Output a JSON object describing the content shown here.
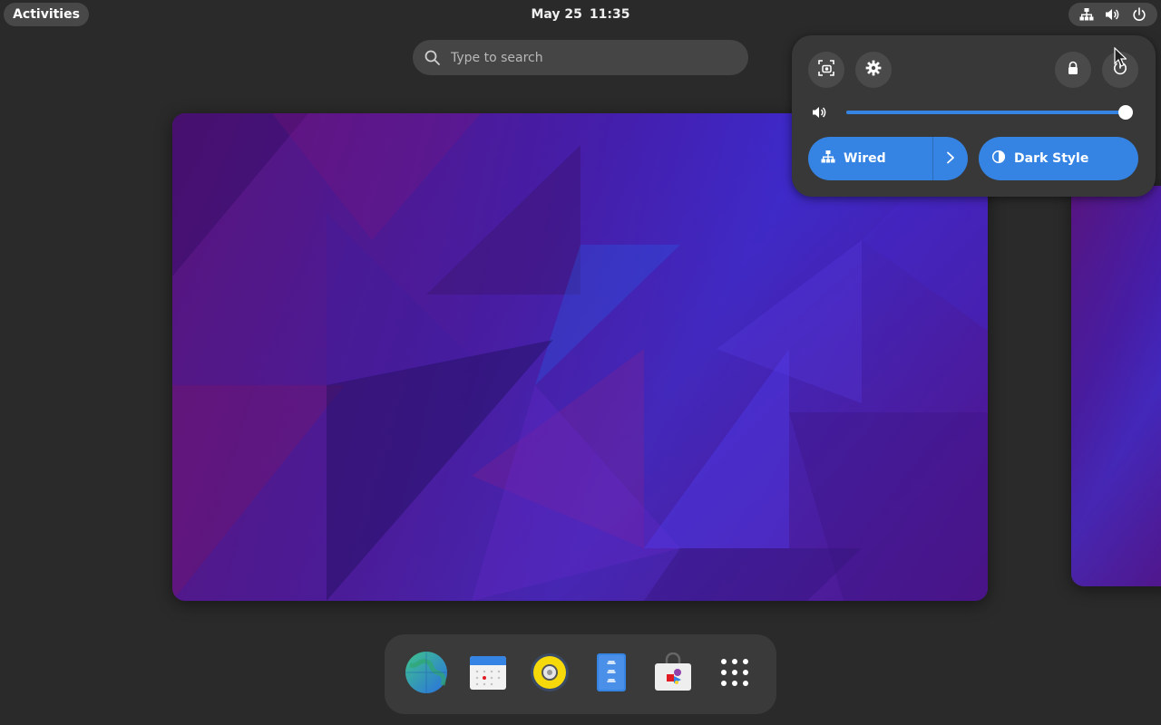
{
  "topbar": {
    "activities_label": "Activities",
    "date": "May 25",
    "time": "11:35",
    "indicators": [
      "network-wired-icon",
      "volume-icon",
      "power-icon"
    ]
  },
  "search": {
    "placeholder": "Type to search"
  },
  "quick_settings": {
    "buttons": [
      "screenshot-icon",
      "settings-gear-icon",
      "lock-icon",
      "power-off-icon"
    ],
    "volume": {
      "level_percent": 100
    },
    "toggles": [
      {
        "label": "Wired",
        "icon": "network-wired-icon",
        "active": true,
        "has_arrow": true
      },
      {
        "label": "Dark Style",
        "icon": "dark-style-icon",
        "active": true,
        "has_arrow": false
      }
    ]
  },
  "dock": {
    "apps": [
      {
        "name": "web-browser-icon"
      },
      {
        "name": "calendar-icon"
      },
      {
        "name": "music-player-icon"
      },
      {
        "name": "text-editor-icon"
      },
      {
        "name": "software-store-icon"
      },
      {
        "name": "show-apps-grid-icon"
      }
    ]
  },
  "colors": {
    "accent": "#3584e4",
    "panel_bg": "#2a2a2a",
    "popover_bg": "#383838"
  }
}
